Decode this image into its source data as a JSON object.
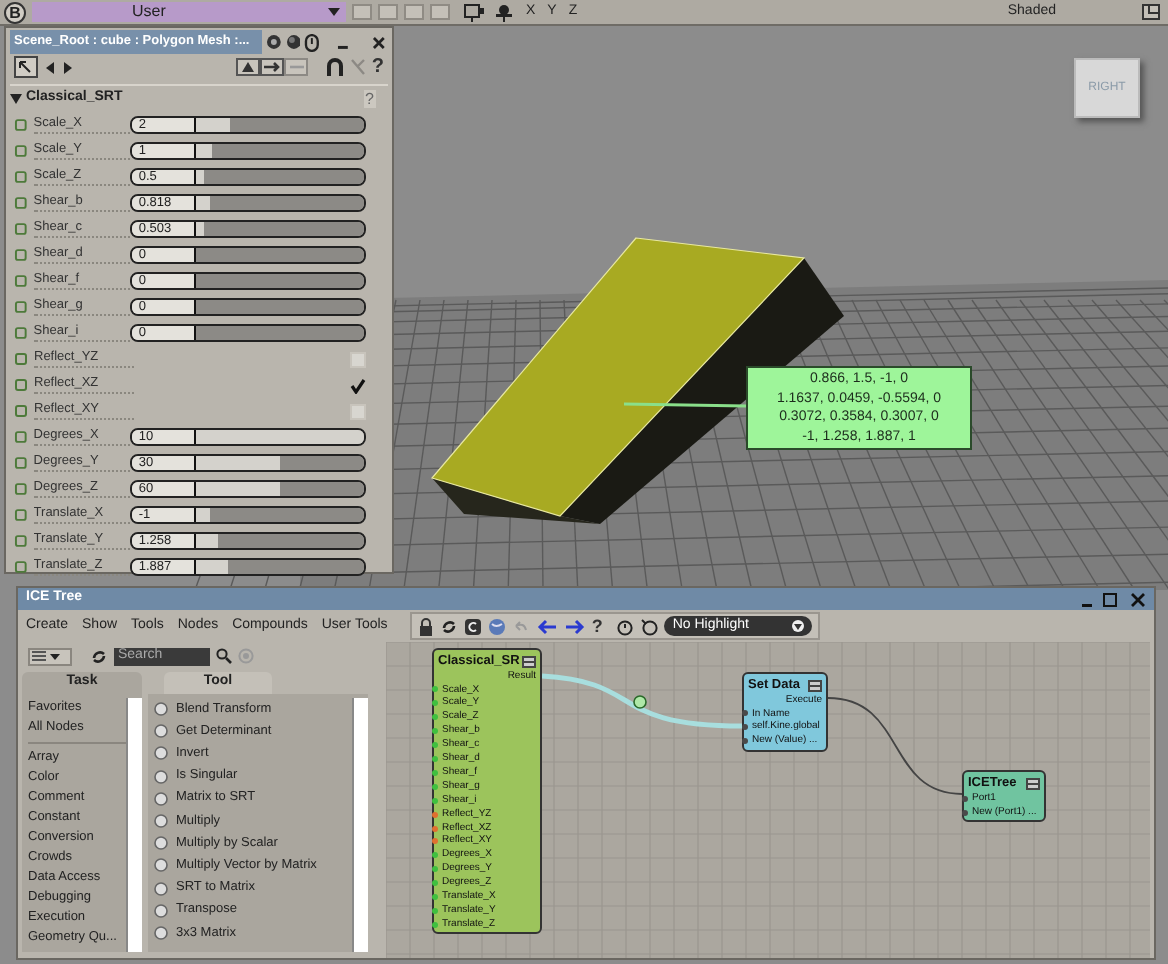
{
  "top_bar": {
    "logo": "B",
    "layout_menu": "User",
    "axes": [
      "X",
      "Y",
      "Z"
    ],
    "display_mode": "Shaded"
  },
  "viewport": {
    "view_cube": "RIGHT",
    "matrix_tooltip": [
      "0.866,  1.5,  -1,  0",
      "1.1637,  0.0459,  -0.5594,  0",
      "0.3072,  0.3584,  0.3007,  0",
      "-1,  1.258,  1.887,  1"
    ]
  },
  "property_editor": {
    "title": "Scene_Root : cube : Polygon Mesh :...",
    "help": "?",
    "section": {
      "title": "Classical_SRT",
      "expanded": true,
      "help": "?"
    },
    "params": [
      {
        "name": "Scale_X",
        "kind": "slider",
        "value": "2",
        "level": 0.2
      },
      {
        "name": "Scale_Y",
        "kind": "slider",
        "value": "1",
        "level": 0.09
      },
      {
        "name": "Scale_Z",
        "kind": "slider",
        "value": "0.5",
        "level": 0.04
      },
      {
        "name": "Shear_b",
        "kind": "slider",
        "value": "0.818",
        "level": 0.08
      },
      {
        "name": "Shear_c",
        "kind": "slider",
        "value": "0.503",
        "level": 0.04
      },
      {
        "name": "Shear_d",
        "kind": "slider",
        "value": "0",
        "level": 0
      },
      {
        "name": "Shear_f",
        "kind": "slider",
        "value": "0",
        "level": 0
      },
      {
        "name": "Shear_g",
        "kind": "slider",
        "value": "0",
        "level": 0
      },
      {
        "name": "Shear_i",
        "kind": "slider",
        "value": "0",
        "level": 0
      },
      {
        "name": "Reflect_YZ",
        "kind": "checkbox",
        "checked": false
      },
      {
        "name": "Reflect_XZ",
        "kind": "checkbox",
        "checked": true
      },
      {
        "name": "Reflect_XY",
        "kind": "checkbox",
        "checked": false
      },
      {
        "name": "Degrees_X",
        "kind": "slider",
        "value": "10",
        "level": 1
      },
      {
        "name": "Degrees_Y",
        "kind": "slider",
        "value": "30",
        "level": 0.5
      },
      {
        "name": "Degrees_Z",
        "kind": "slider",
        "value": "60",
        "level": 0.5
      },
      {
        "name": "Translate_X",
        "kind": "slider",
        "value": "-1",
        "level": 0.08
      },
      {
        "name": "Translate_Y",
        "kind": "slider",
        "value": "1.258",
        "level": 0.13
      },
      {
        "name": "Translate_Z",
        "kind": "slider",
        "value": "1.887",
        "level": 0.19
      }
    ]
  },
  "ice_tree": {
    "title": "ICE Tree",
    "menu": [
      "Create",
      "Show",
      "Tools",
      "Nodes",
      "Compounds",
      "User Tools"
    ],
    "help": "?",
    "highlight": "No Highlight",
    "search": {
      "placeholder": "Search"
    },
    "columns": [
      "Task",
      "Tool"
    ],
    "task_groups": [
      [
        "Favorites",
        "All Nodes"
      ],
      [
        "Array",
        "Color",
        "Comment",
        "Constant",
        "Conversion",
        "Crowds",
        "Data Access",
        "Debugging",
        "Execution",
        "Geometry Qu..."
      ]
    ],
    "tool_items": [
      "Blend Transform",
      "Get Determinant",
      "Invert",
      "Is Singular",
      "Matrix to SRT",
      "Multiply",
      "Multiply by Scalar",
      "Multiply Vector by Matrix",
      "SRT to Matrix",
      "Transpose",
      "3x3 Matrix"
    ],
    "nodes": [
      {
        "title": "Classical_SR",
        "color": "#9cc45c",
        "outputs": [
          "Result"
        ],
        "inputs": [
          {
            "name": "Scale_X",
            "kind": "scalar"
          },
          {
            "name": "Scale_Y",
            "kind": "scalar"
          },
          {
            "name": "Scale_Z",
            "kind": "scalar"
          },
          {
            "name": "Shear_b",
            "kind": "scalar"
          },
          {
            "name": "Shear_c",
            "kind": "scalar"
          },
          {
            "name": "Shear_d",
            "kind": "scalar"
          },
          {
            "name": "Shear_f",
            "kind": "scalar"
          },
          {
            "name": "Shear_g",
            "kind": "scalar"
          },
          {
            "name": "Shear_i",
            "kind": "scalar"
          },
          {
            "name": "Reflect_YZ",
            "kind": "boolean"
          },
          {
            "name": "Reflect_XZ",
            "kind": "boolean"
          },
          {
            "name": "Reflect_XY",
            "kind": "boolean"
          },
          {
            "name": "Degrees_X",
            "kind": "scalar"
          },
          {
            "name": "Degrees_Y",
            "kind": "scalar"
          },
          {
            "name": "Degrees_Z",
            "kind": "scalar"
          },
          {
            "name": "Translate_X",
            "kind": "scalar"
          },
          {
            "name": "Translate_Y",
            "kind": "scalar"
          },
          {
            "name": "Translate_Z",
            "kind": "scalar"
          }
        ]
      },
      {
        "title": "Set Data",
        "color": "#80c8dc",
        "outputs": [
          "Execute"
        ],
        "inputs": [
          {
            "name": "In Name",
            "kind": "generic"
          },
          {
            "name": "self.Kine.global",
            "kind": "generic"
          },
          {
            "name": "New (Value) ...",
            "kind": "generic"
          }
        ]
      },
      {
        "title": "ICETree",
        "color": "#70c4a0",
        "inputs": [
          {
            "name": "Port1",
            "kind": "generic"
          },
          {
            "name": "New (Port1) ...",
            "kind": "generic"
          }
        ]
      }
    ]
  }
}
